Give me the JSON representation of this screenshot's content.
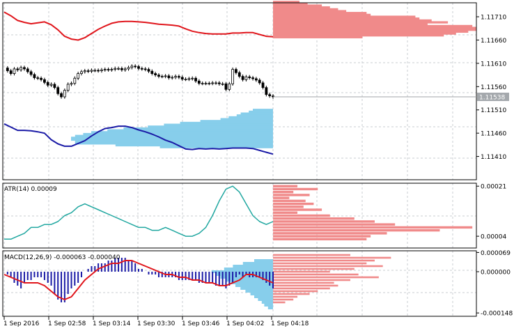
{
  "chart_data": [
    {
      "type": "line",
      "panel": "main",
      "grid": true,
      "ylim": [
        1.1136,
        1.1174
      ],
      "y_ticks": [
        "1.11710",
        "1.11660",
        "1.11610",
        "1.11560",
        "1.11510",
        "1.11460",
        "1.11410"
      ],
      "current_price_label": "1.11538",
      "colors": {
        "upper_line": "#e0151b",
        "lower_line": "#1a1aa6",
        "upper_hist": "#f08a8a",
        "lower_hist": "#87ceeb",
        "candles": "#000000"
      },
      "series": [
        {
          "role": "upper-line",
          "x": [
            0,
            2,
            4,
            6,
            8,
            10,
            12,
            14,
            16,
            18,
            20,
            22,
            24,
            26,
            28,
            30,
            32,
            34,
            36,
            38,
            40,
            42,
            44,
            46,
            48,
            50,
            52,
            54,
            56,
            58,
            60,
            62,
            64,
            66,
            68,
            70,
            72,
            74,
            76,
            78,
            80
          ],
          "values": [
            1.1172,
            1.11712,
            1.11702,
            1.11698,
            1.11695,
            1.11697,
            1.11699,
            1.11693,
            1.11682,
            1.11668,
            1.11662,
            1.1166,
            1.11665,
            1.11674,
            1.11683,
            1.1169,
            1.11696,
            1.11699,
            1.117,
            1.117,
            1.11699,
            1.11698,
            1.11696,
            1.11694,
            1.11693,
            1.11692,
            1.1169,
            1.11684,
            1.11679,
            1.11676,
            1.11674,
            1.11673,
            1.11673,
            1.11673,
            1.11675,
            1.11675,
            1.11676,
            1.11676,
            1.11672,
            1.11668,
            1.11667
          ]
        },
        {
          "role": "lower-line",
          "x": [
            0,
            2,
            4,
            6,
            8,
            10,
            12,
            14,
            16,
            18,
            20,
            22,
            24,
            26,
            28,
            30,
            32,
            34,
            36,
            38,
            40,
            42,
            44,
            46,
            48,
            50,
            52,
            54,
            56,
            58,
            60,
            62,
            64,
            66,
            68,
            70,
            72,
            74,
            76,
            78,
            80
          ],
          "values": [
            1.1148,
            1.11473,
            1.11466,
            1.11466,
            1.11465,
            1.11463,
            1.1146,
            1.11446,
            1.11437,
            1.11432,
            1.11432,
            1.11438,
            1.11444,
            1.11454,
            1.11463,
            1.1147,
            1.11472,
            1.11475,
            1.11475,
            1.11472,
            1.11467,
            1.11463,
            1.11458,
            1.11452,
            1.11445,
            1.1144,
            1.11433,
            1.11426,
            1.11425,
            1.11427,
            1.11426,
            1.11427,
            1.11426,
            1.11427,
            1.11428,
            1.11428,
            1.11428,
            1.11427,
            1.11423,
            1.11419,
            1.11415
          ]
        },
        {
          "role": "candles",
          "x": [
            1,
            2,
            3,
            4,
            5,
            6,
            7,
            8,
            9,
            10,
            11,
            12,
            13,
            14,
            15,
            16,
            17,
            18,
            19,
            20,
            21,
            22,
            23,
            24,
            25,
            26,
            27,
            28,
            29,
            30,
            31,
            32,
            33,
            34,
            35,
            36,
            37,
            38,
            39,
            40,
            41,
            42,
            43,
            44,
            45,
            46,
            47,
            48,
            49,
            50,
            51,
            52,
            53,
            54,
            55,
            56,
            57,
            58,
            59,
            60,
            61,
            62,
            63,
            64,
            65,
            66,
            67,
            68,
            69,
            70,
            71,
            72,
            73,
            74,
            75,
            76,
            77,
            78,
            79,
            80
          ],
          "open": [
            1.116,
            1.11594,
            1.11588,
            1.11598,
            1.11596,
            1.11601,
            1.11598,
            1.11592,
            1.11586,
            1.11579,
            1.11578,
            1.11575,
            1.11569,
            1.11563,
            1.11565,
            1.11558,
            1.11545,
            1.11538,
            1.11552,
            1.11565,
            1.11567,
            1.11578,
            1.11588,
            1.11592,
            1.11594,
            1.11593,
            1.11595,
            1.11595,
            1.11594,
            1.11596,
            1.11597,
            1.11596,
            1.11597,
            1.11599,
            1.11599,
            1.11596,
            1.11598,
            1.11601,
            1.11604,
            1.11603,
            1.11599,
            1.11598,
            1.11597,
            1.11593,
            1.11588,
            1.11585,
            1.11582,
            1.11582,
            1.11583,
            1.11579,
            1.1158,
            1.11582,
            1.1158,
            1.11576,
            1.11576,
            1.11577,
            1.11578,
            1.11572,
            1.11567,
            1.11567,
            1.11567,
            1.11567,
            1.11568,
            1.11568,
            1.11566,
            1.11566,
            1.11554,
            1.11566,
            1.11597,
            1.1159,
            1.11582,
            1.11575,
            1.11581,
            1.11579,
            1.11577,
            1.11574,
            1.11568,
            1.11558,
            1.11543,
            1.1154
          ],
          "close": [
            1.11594,
            1.11588,
            1.11598,
            1.11596,
            1.11601,
            1.11598,
            1.11592,
            1.11586,
            1.11579,
            1.11578,
            1.11575,
            1.11569,
            1.11563,
            1.11565,
            1.11558,
            1.11545,
            1.11538,
            1.11552,
            1.11565,
            1.11567,
            1.11578,
            1.11588,
            1.11592,
            1.11594,
            1.11593,
            1.11595,
            1.11595,
            1.11594,
            1.11596,
            1.11597,
            1.11596,
            1.11597,
            1.11599,
            1.11599,
            1.11596,
            1.11598,
            1.11601,
            1.11604,
            1.11603,
            1.11599,
            1.11598,
            1.11597,
            1.11593,
            1.11588,
            1.11585,
            1.11582,
            1.11582,
            1.11583,
            1.11579,
            1.1158,
            1.11582,
            1.1158,
            1.11576,
            1.11576,
            1.11577,
            1.11578,
            1.11572,
            1.11567,
            1.11567,
            1.11567,
            1.11567,
            1.11568,
            1.11568,
            1.11566,
            1.11566,
            1.11554,
            1.11566,
            1.11597,
            1.1159,
            1.11582,
            1.11575,
            1.11581,
            1.11579,
            1.11577,
            1.11574,
            1.11568,
            1.11558,
            1.11543,
            1.1154,
            1.11538
          ]
        },
        {
          "role": "upper-histogram",
          "y": [
            1.11742,
            1.11738,
            1.11734,
            1.1173,
            1.11726,
            1.11722,
            1.11718,
            1.11714,
            1.1171,
            1.11706,
            1.11702,
            1.11698,
            1.11694,
            1.1169,
            1.11686,
            1.11682,
            1.11678,
            1.11674,
            1.1167,
            1.11666
          ],
          "values": [
            0.13,
            0.17,
            0.24,
            0.28,
            0.32,
            0.36,
            0.46,
            0.48,
            0.7,
            0.72,
            0.78,
            0.86,
            0.76,
            0.98,
            1.0,
            1.0,
            0.96,
            0.9,
            0.84,
            0.44
          ]
        },
        {
          "role": "lower-histogram",
          "y": [
            1.1151,
            1.11506,
            1.11502,
            1.11498,
            1.11494,
            1.1149,
            1.11486,
            1.11482,
            1.11478,
            1.11474,
            1.1147,
            1.11466,
            1.11462,
            1.11458,
            1.11454,
            1.1145,
            1.11446,
            1.11442,
            1.11438,
            1.11434,
            1.1143
          ],
          "values": [
            0.1,
            0.12,
            0.16,
            0.18,
            0.22,
            0.26,
            0.36,
            0.46,
            0.54,
            0.62,
            0.74,
            0.82,
            0.9,
            0.94,
            0.98,
            1.0,
            1.0,
            0.98,
            0.98,
            0.78,
            0.56
          ]
        }
      ]
    },
    {
      "type": "line",
      "panel": "atr",
      "title": "ATR(14) 0.00009",
      "grid": true,
      "ylim": [
        0.0,
        0.00022
      ],
      "y_ticks": [
        "0.00021",
        "0.00004"
      ],
      "colors": {
        "line": "#20a7a0",
        "hist": "#f08a8a"
      },
      "series": [
        {
          "role": "atr-line",
          "x": [
            0,
            2,
            4,
            6,
            8,
            10,
            12,
            14,
            16,
            18,
            20,
            22,
            24,
            26,
            28,
            30,
            32,
            34,
            36,
            38,
            40,
            42,
            44,
            46,
            48,
            50,
            52,
            54,
            56,
            58,
            60,
            62,
            64,
            66,
            68,
            70,
            72,
            74,
            76,
            78,
            80
          ],
          "values": [
            3e-05,
            3e-05,
            4e-05,
            5e-05,
            7e-05,
            7e-05,
            8e-05,
            8e-05,
            9e-05,
            0.00011,
            0.00012,
            0.00014,
            0.00015,
            0.00014,
            0.00013,
            0.00012,
            0.00011,
            0.0001,
            9e-05,
            8e-05,
            7e-05,
            7e-05,
            6e-05,
            6e-05,
            7e-05,
            6e-05,
            5e-05,
            4e-05,
            4e-05,
            5e-05,
            7e-05,
            0.00011,
            0.00016,
            0.0002,
            0.00021,
            0.00019,
            0.00015,
            0.00011,
            9e-05,
            8e-05,
            9e-05
          ]
        },
        {
          "role": "atr-histogram",
          "y": [
            0.00021,
            0.0002,
            0.00019,
            0.00018,
            0.00017,
            0.00016,
            0.00015,
            0.00014,
            0.00013,
            0.00012,
            0.00011,
            0.0001,
            9e-05,
            8e-05,
            7e-05,
            6e-05,
            5e-05,
            4e-05,
            3e-05
          ],
          "values": [
            0.12,
            0.22,
            0.1,
            0.18,
            0.08,
            0.16,
            0.2,
            0.15,
            0.24,
            0.12,
            0.28,
            0.4,
            0.5,
            0.6,
            0.98,
            0.82,
            0.56,
            0.48,
            0.46
          ]
        }
      ]
    },
    {
      "type": "bar",
      "panel": "macd",
      "title": "MACD(12,26,9) -0.000063 -0.000040",
      "grid": true,
      "ylim": [
        -0.00016,
        7.5e-05
      ],
      "y_ticks": [
        "0.000069",
        "0.000000",
        "-0.000148"
      ],
      "colors": {
        "bars": "#1a1aa6",
        "signal": "#e0151b",
        "hist_pos": "#87ceeb",
        "hist_neg": "#f08a8a"
      },
      "series": [
        {
          "role": "macd-bars",
          "x": [
            1,
            2,
            3,
            4,
            5,
            6,
            7,
            8,
            9,
            10,
            11,
            12,
            13,
            14,
            15,
            16,
            17,
            18,
            19,
            20,
            21,
            22,
            23,
            24,
            25,
            26,
            27,
            28,
            29,
            30,
            31,
            32,
            33,
            34,
            35,
            36,
            37,
            38,
            39,
            40,
            41,
            42,
            43,
            44,
            45,
            46,
            47,
            48,
            49,
            50,
            51,
            52,
            53,
            54,
            55,
            56,
            57,
            58,
            59,
            60,
            61,
            62,
            63,
            64,
            65,
            66,
            67,
            68,
            69,
            70,
            71,
            72,
            73,
            74,
            75,
            76,
            77,
            78,
            79,
            80
          ],
          "values": [
            -1e-05,
            -2e-05,
            -4e-05,
            -5e-05,
            -6e-05,
            -4e-05,
            -3e-05,
            -3e-05,
            -2e-05,
            -2e-05,
            -2e-05,
            -3e-05,
            -4e-05,
            -5e-05,
            -8e-05,
            -0.0001,
            -0.00011,
            -0.00011,
            -8e-05,
            -6e-05,
            -5e-05,
            -4e-05,
            -2e-05,
            0.0,
            1e-05,
            2e-05,
            2e-05,
            3e-05,
            3e-05,
            3e-05,
            4e-05,
            4e-05,
            5e-05,
            5e-05,
            5e-05,
            5e-05,
            4e-05,
            4e-05,
            3e-05,
            1e-05,
            1e-05,
            0.0,
            -1e-05,
            -1e-05,
            -1e-05,
            -2e-05,
            -2e-05,
            -2e-05,
            -2e-05,
            -2e-05,
            -2e-05,
            -3e-05,
            -3e-05,
            -3e-05,
            -3e-05,
            -3e-05,
            -3e-05,
            -4e-05,
            -4e-05,
            -4e-05,
            -4e-05,
            -4e-05,
            -5e-05,
            -5e-05,
            -5e-05,
            -6e-05,
            -5e-05,
            -4e-05,
            -2e-05,
            -1e-05,
            -2e-05,
            -1e-05,
            -2e-05,
            -2e-05,
            -2e-05,
            -2e-05,
            -3e-05,
            -4e-05,
            -5e-05,
            -6e-05
          ]
        },
        {
          "role": "signal-line",
          "x": [
            0,
            2,
            4,
            6,
            8,
            10,
            12,
            14,
            16,
            18,
            20,
            22,
            24,
            26,
            28,
            30,
            32,
            34,
            36,
            38,
            40,
            42,
            44,
            46,
            48,
            50,
            52,
            54,
            56,
            58,
            60,
            62,
            64,
            66,
            68,
            70,
            72,
            74,
            76,
            78,
            80
          ],
          "values": [
            -1e-05,
            -2e-05,
            -3e-05,
            -4e-05,
            -4e-05,
            -4e-05,
            -5e-05,
            -7e-05,
            -9e-05,
            -0.0001,
            -9e-05,
            -6e-05,
            -3e-05,
            -1e-05,
            1e-05,
            2e-05,
            3e-05,
            3e-05,
            4e-05,
            4e-05,
            3e-05,
            2e-05,
            1e-05,
            0.0,
            -1e-05,
            -1e-05,
            -2e-05,
            -2e-05,
            -3e-05,
            -3e-05,
            -4e-05,
            -4e-05,
            -5e-05,
            -5e-05,
            -4e-05,
            -3e-05,
            -1e-05,
            -1e-05,
            -2e-05,
            -3e-05,
            -4e-05
          ]
        },
        {
          "role": "hist-positive",
          "y": [
            4e-05,
            3e-05,
            2e-05,
            1e-05,
            0.0,
            -1e-05,
            -2e-05,
            -3e-05,
            -4e-05,
            -5e-05,
            -6e-05,
            -7e-05,
            -8e-05,
            -9e-05,
            -0.0001,
            -0.00011,
            -0.00012,
            -0.00013
          ],
          "values": [
            0.3,
            0.48,
            0.64,
            0.78,
            0.98,
            0.92,
            0.84,
            0.76,
            0.68,
            0.6,
            0.52,
            0.44,
            0.36,
            0.3,
            0.24,
            0.18,
            0.14,
            0.08
          ]
        },
        {
          "role": "hist-negative",
          "y": [
            6e-05,
            5e-05,
            4e-05,
            3e-05,
            2e-05,
            1e-05,
            0.0,
            -1e-05,
            -2e-05,
            -3e-05,
            -4e-05,
            -5e-05,
            -6e-05,
            -7e-05,
            -8e-05,
            -9e-05,
            -0.0001,
            -0.00011
          ],
          "values": [
            0.38,
            0.58,
            0.5,
            0.46,
            0.54,
            0.4,
            0.28,
            0.42,
            0.52,
            0.38,
            0.3,
            0.32,
            0.28,
            0.22,
            0.18,
            0.12,
            0.1,
            0.06
          ]
        }
      ]
    }
  ],
  "x_axis": {
    "labels": [
      "1 Sep 2016",
      "1 Sep 02:58",
      "1 Sep 03:14",
      "1 Sep 03:30",
      "1 Sep 03:46",
      "1 Sep 04:02",
      "1 Sep 04:18"
    ]
  }
}
